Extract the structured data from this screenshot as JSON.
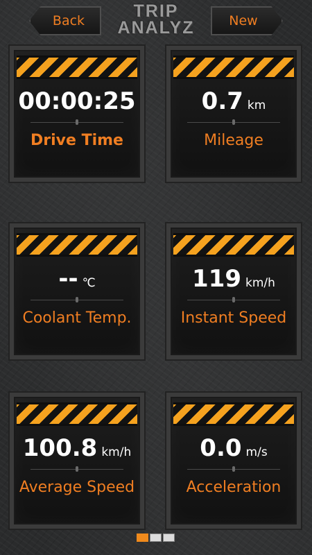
{
  "header": {
    "back_label": "Back",
    "new_label": "New",
    "logo_line1": "TRIP",
    "logo_line2": "ANALYZ"
  },
  "tiles": [
    {
      "value": "00:00:25",
      "unit": "",
      "label": "Drive Time"
    },
    {
      "value": "0.7",
      "unit": "km",
      "label": "Mileage"
    },
    {
      "value": "--",
      "unit": "℃",
      "label": "Coolant Temp."
    },
    {
      "value": "119",
      "unit": "km/h",
      "label": "Instant Speed"
    },
    {
      "value": "100.8",
      "unit": "km/h",
      "label": "Average Speed"
    },
    {
      "value": "0.0",
      "unit": "m/s",
      "label": "Acceleration"
    }
  ],
  "pager": {
    "pages": 3,
    "active_page": 1
  },
  "colors": {
    "accent": "#f07e22",
    "hazard_yellow": "#f5a21f",
    "value_text": "#ffffff"
  }
}
